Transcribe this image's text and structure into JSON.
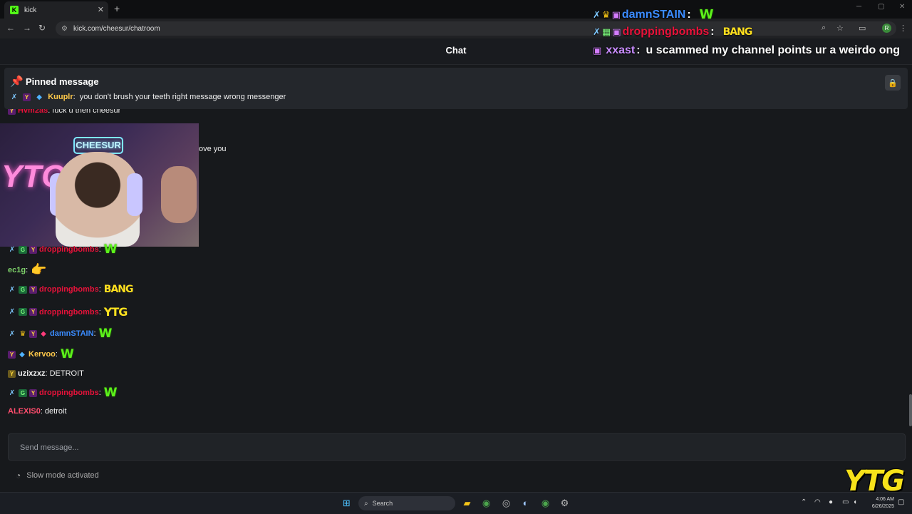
{
  "browser": {
    "tab_title": "kick",
    "tab_favicon": "K",
    "new_tab": "+",
    "url": "kick.com/cheesur/chatroom",
    "profile_initial": "R"
  },
  "chat": {
    "title": "Chat",
    "pinned": {
      "title": "Pinned message",
      "user": "Kuuplr",
      "text": "you don't brush your teeth right message wrong messenger"
    },
    "partial_messages": {
      "first_user": "Hvm2as",
      "first_text": "fuck u then cheesur",
      "second_text": "ove you"
    },
    "messages": [
      {
        "user": "droppingbombs",
        "color": "#e8123a",
        "emote": "W"
      },
      {
        "user": "ec1g",
        "color": "#7fd46b",
        "emote": "👉"
      },
      {
        "user": "droppingbombs",
        "color": "#e8123a",
        "emote": "BANG"
      },
      {
        "user": "droppingbombs",
        "color": "#e8123a",
        "emote": "YTG"
      },
      {
        "user": "damnSTAIN",
        "color": "#3b8cff",
        "emote": "W"
      },
      {
        "user": "Kervoo",
        "color": "#ffc94a",
        "emote": "W"
      },
      {
        "user": "uzixzxz",
        "color": "#f0f0f0",
        "text": "DETROIT"
      },
      {
        "user": "droppingbombs",
        "color": "#e8123a",
        "emote": "W"
      },
      {
        "user": "ALEXIS0",
        "color": "#ff4d6d",
        "text": "detroit"
      }
    ],
    "composer_placeholder": "Send message...",
    "slow_mode": "Slow mode activated"
  },
  "overlay": [
    {
      "user": "damnSTAIN",
      "color": "#3b8cff",
      "emote": "W"
    },
    {
      "user": "droppingbombs",
      "color": "#e8123a",
      "emote": "BANG"
    },
    {
      "user": "xxast",
      "color": "#c98cff",
      "text": "u scammed my channel points ur a weirdo ong"
    }
  ],
  "webcam": {
    "sign": "CHEESUR",
    "neon": "YTG"
  },
  "taskbar": {
    "search": "Search",
    "time": "4:06 AM",
    "date": "6/26/2025"
  },
  "stream_logo": "YTG",
  "icons": [
    "pin-icon",
    "lock-icon",
    "snail-icon",
    "search-icon",
    "windows-icon",
    "star-icon",
    "back-icon",
    "forward-icon",
    "reload-icon"
  ]
}
